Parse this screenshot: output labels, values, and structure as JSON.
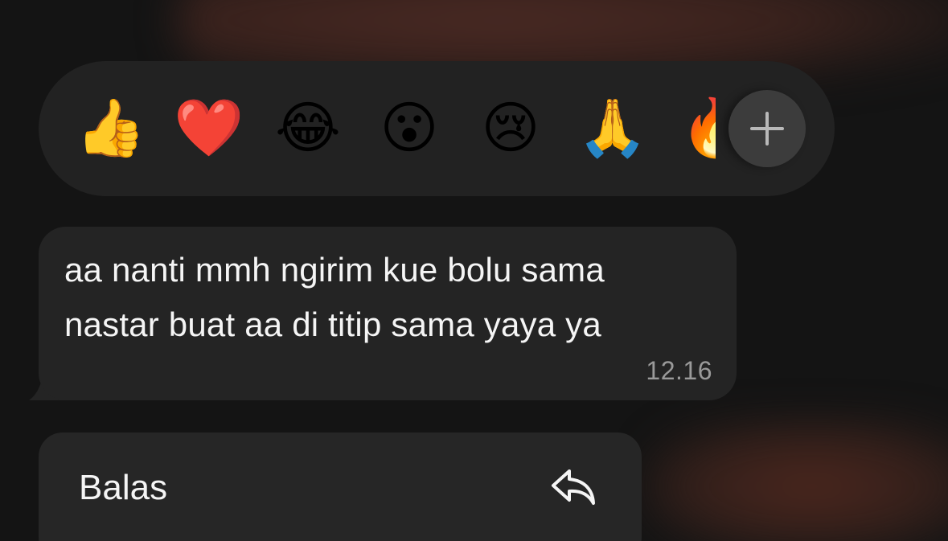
{
  "reactions": {
    "items": [
      {
        "emoji": "👍",
        "name": "thumbs-up"
      },
      {
        "emoji": "❤️",
        "name": "red-heart"
      },
      {
        "emoji": "😂",
        "name": "tears-of-joy"
      },
      {
        "emoji": "😮",
        "name": "surprised"
      },
      {
        "emoji": "😢",
        "name": "crying"
      },
      {
        "emoji": "🙏",
        "name": "folded-hands"
      },
      {
        "emoji": "🔥",
        "name": "fire"
      }
    ],
    "more_icon": "plus-icon"
  },
  "message": {
    "line1": "aa nanti mmh ngirim kue bolu sama",
    "line2": "nastar buat aa di titip sama yaya ya",
    "time": "12.16"
  },
  "menu": {
    "reply_label": "Balas",
    "reply_icon": "reply-arrow-icon"
  },
  "colors": {
    "background": "#141414",
    "surface": "#222222",
    "bubble": "#242424",
    "text": "#f5f5f5",
    "muted": "#9a9a9a"
  }
}
